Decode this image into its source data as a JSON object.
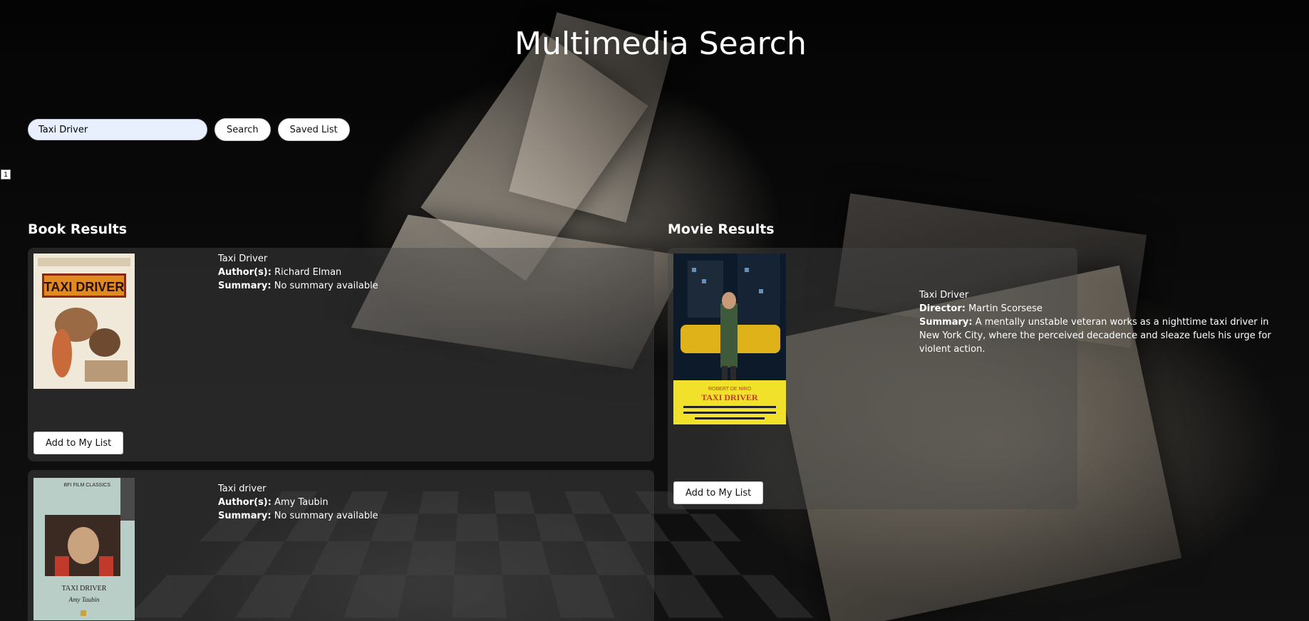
{
  "app": {
    "title": "Multimedia Search"
  },
  "search": {
    "value": "Taxi Driver",
    "search_label": "Search",
    "saved_list_label": "Saved List"
  },
  "pagination": {
    "current_page": "1"
  },
  "books": {
    "heading": "Book Results",
    "items": [
      {
        "title": "Taxi Driver",
        "author_label": "Author(s):",
        "author": "Richard Elman",
        "summary_label": "Summary:",
        "summary": "No summary available",
        "cover_title": "TAXI DRIVER",
        "add_label": "Add to My List"
      },
      {
        "title": "Taxi driver",
        "author_label": "Author(s):",
        "author": "Amy Taubin",
        "summary_label": "Summary:",
        "summary": "No summary available",
        "cover_badge": "BFI FILM CLASSICS",
        "cover_title": "TAXI DRIVER",
        "cover_author": "Amy Taubin"
      }
    ]
  },
  "movies": {
    "heading": "Movie Results",
    "items": [
      {
        "title": "Taxi Driver",
        "director_label": "Director:",
        "director": "Martin Scorsese",
        "summary_label": "Summary:",
        "summary": "A mentally unstable veteran works as a nighttime taxi driver in New York City, where the perceived decadence and sleaze fuels his urge for violent action.",
        "poster_star": "ROBERT DE NIRO",
        "poster_title": "TAXI DRIVER",
        "add_label": "Add to My List"
      }
    ]
  },
  "colors": {
    "background": "#000000",
    "card_overlay": "#464646",
    "input_bg": "#e8f0fe",
    "button_bg": "#ffffff"
  }
}
